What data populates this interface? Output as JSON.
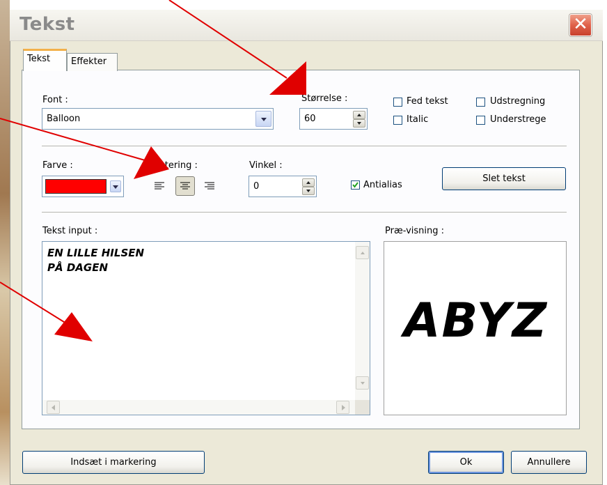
{
  "window": {
    "title": "Tekst",
    "close_glyph": "✕"
  },
  "tabs": [
    {
      "label": "Tekst"
    },
    {
      "label": "Effekter"
    }
  ],
  "font": {
    "label": "Font :",
    "value": "Balloon"
  },
  "size": {
    "label": "Størrelse :",
    "value": "60"
  },
  "style_options": {
    "bold": {
      "label": "Fed tekst",
      "checked": false
    },
    "italic": {
      "label": "Italic",
      "checked": false
    },
    "strikethrough": {
      "label": "Udstregning",
      "checked": false
    },
    "underline": {
      "label": "Understrege",
      "checked": false
    }
  },
  "color": {
    "label": "Farve :",
    "value": "#ff0000"
  },
  "alignment": {
    "label": "stering :",
    "selected": "center",
    "options": [
      "left-align-icon",
      "center-align-icon",
      "right-align-icon"
    ]
  },
  "angle": {
    "label": "Vinkel :",
    "value": "0"
  },
  "antialias": {
    "label": "Antialias",
    "checked": true
  },
  "delete_button": "Slet tekst",
  "text_input": {
    "label": "Tekst input :",
    "lines": [
      "EN LILLE HILSEN",
      "PÅ DAGEN"
    ]
  },
  "preview": {
    "label": "Præ-visning :",
    "text": "ABYZ"
  },
  "footer": {
    "insert_button": "Indsæt i markering",
    "ok_button": "Ok",
    "cancel_button": "Annullere"
  },
  "annotation_color": "#e00000"
}
